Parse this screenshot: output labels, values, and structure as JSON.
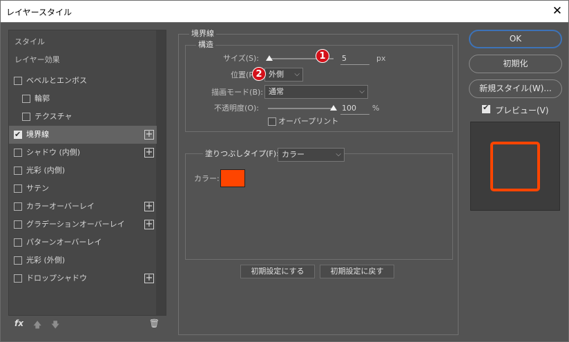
{
  "window": {
    "title": "レイヤースタイル",
    "close_glyph": "✕"
  },
  "style_list": {
    "headers": [
      "スタイル",
      "レイヤー効果"
    ],
    "items": [
      {
        "label": "ベベルとエンボス",
        "checked": false,
        "indent": false,
        "plus": false
      },
      {
        "label": "輪郭",
        "checked": false,
        "indent": true,
        "plus": false
      },
      {
        "label": "テクスチャ",
        "checked": false,
        "indent": true,
        "plus": false
      },
      {
        "label": "境界線",
        "checked": true,
        "indent": false,
        "plus": true,
        "selected": true
      },
      {
        "label": "シャドウ (内側)",
        "checked": false,
        "indent": false,
        "plus": true
      },
      {
        "label": "光彩 (内側)",
        "checked": false,
        "indent": false,
        "plus": false
      },
      {
        "label": "サテン",
        "checked": false,
        "indent": false,
        "plus": false
      },
      {
        "label": "カラーオーバーレイ",
        "checked": false,
        "indent": false,
        "plus": true
      },
      {
        "label": "グラデーションオーバーレイ",
        "checked": false,
        "indent": false,
        "plus": true
      },
      {
        "label": "パターンオーバーレイ",
        "checked": false,
        "indent": false,
        "plus": false
      },
      {
        "label": "光彩 (外側)",
        "checked": false,
        "indent": false,
        "plus": false
      },
      {
        "label": "ドロップシャドウ",
        "checked": false,
        "indent": false,
        "plus": true
      }
    ],
    "check_glyph": "✔",
    "plus_glyph": "+",
    "fx_label": "fx",
    "up_arrow": "🡅",
    "down_arrow": "🡇",
    "trash_glyph": "🗑"
  },
  "stroke": {
    "title": "境界線",
    "structure_title": "構造",
    "size_label": "サイズ(S):",
    "size_value": "5",
    "size_unit": "px",
    "size_slider_fraction": 0.02,
    "position_label": "位置(P):",
    "position_value": "外側",
    "blend_label": "描画モード(B):",
    "blend_value": "通常",
    "opacity_label": "不透明度(O):",
    "opacity_value": "100",
    "opacity_unit": "%",
    "opacity_slider_fraction": 1.0,
    "overprint_label": "オーバープリント",
    "overprint_checked": false,
    "fill_type_label": "塗りつぶしタイプ(F):",
    "fill_type_value": "カラー",
    "color_label": "カラー:",
    "color_hex": "#fe4500",
    "make_default_label": "初期設定にする",
    "reset_default_label": "初期設定に戻す"
  },
  "badges": [
    "1",
    "2"
  ],
  "buttons": {
    "ok": "OK",
    "reset": "初期化",
    "new_style": "新規スタイル(W)...",
    "preview_label": "プレビュー(V)",
    "preview_checked": true
  },
  "chevron_glyph": "⌵"
}
